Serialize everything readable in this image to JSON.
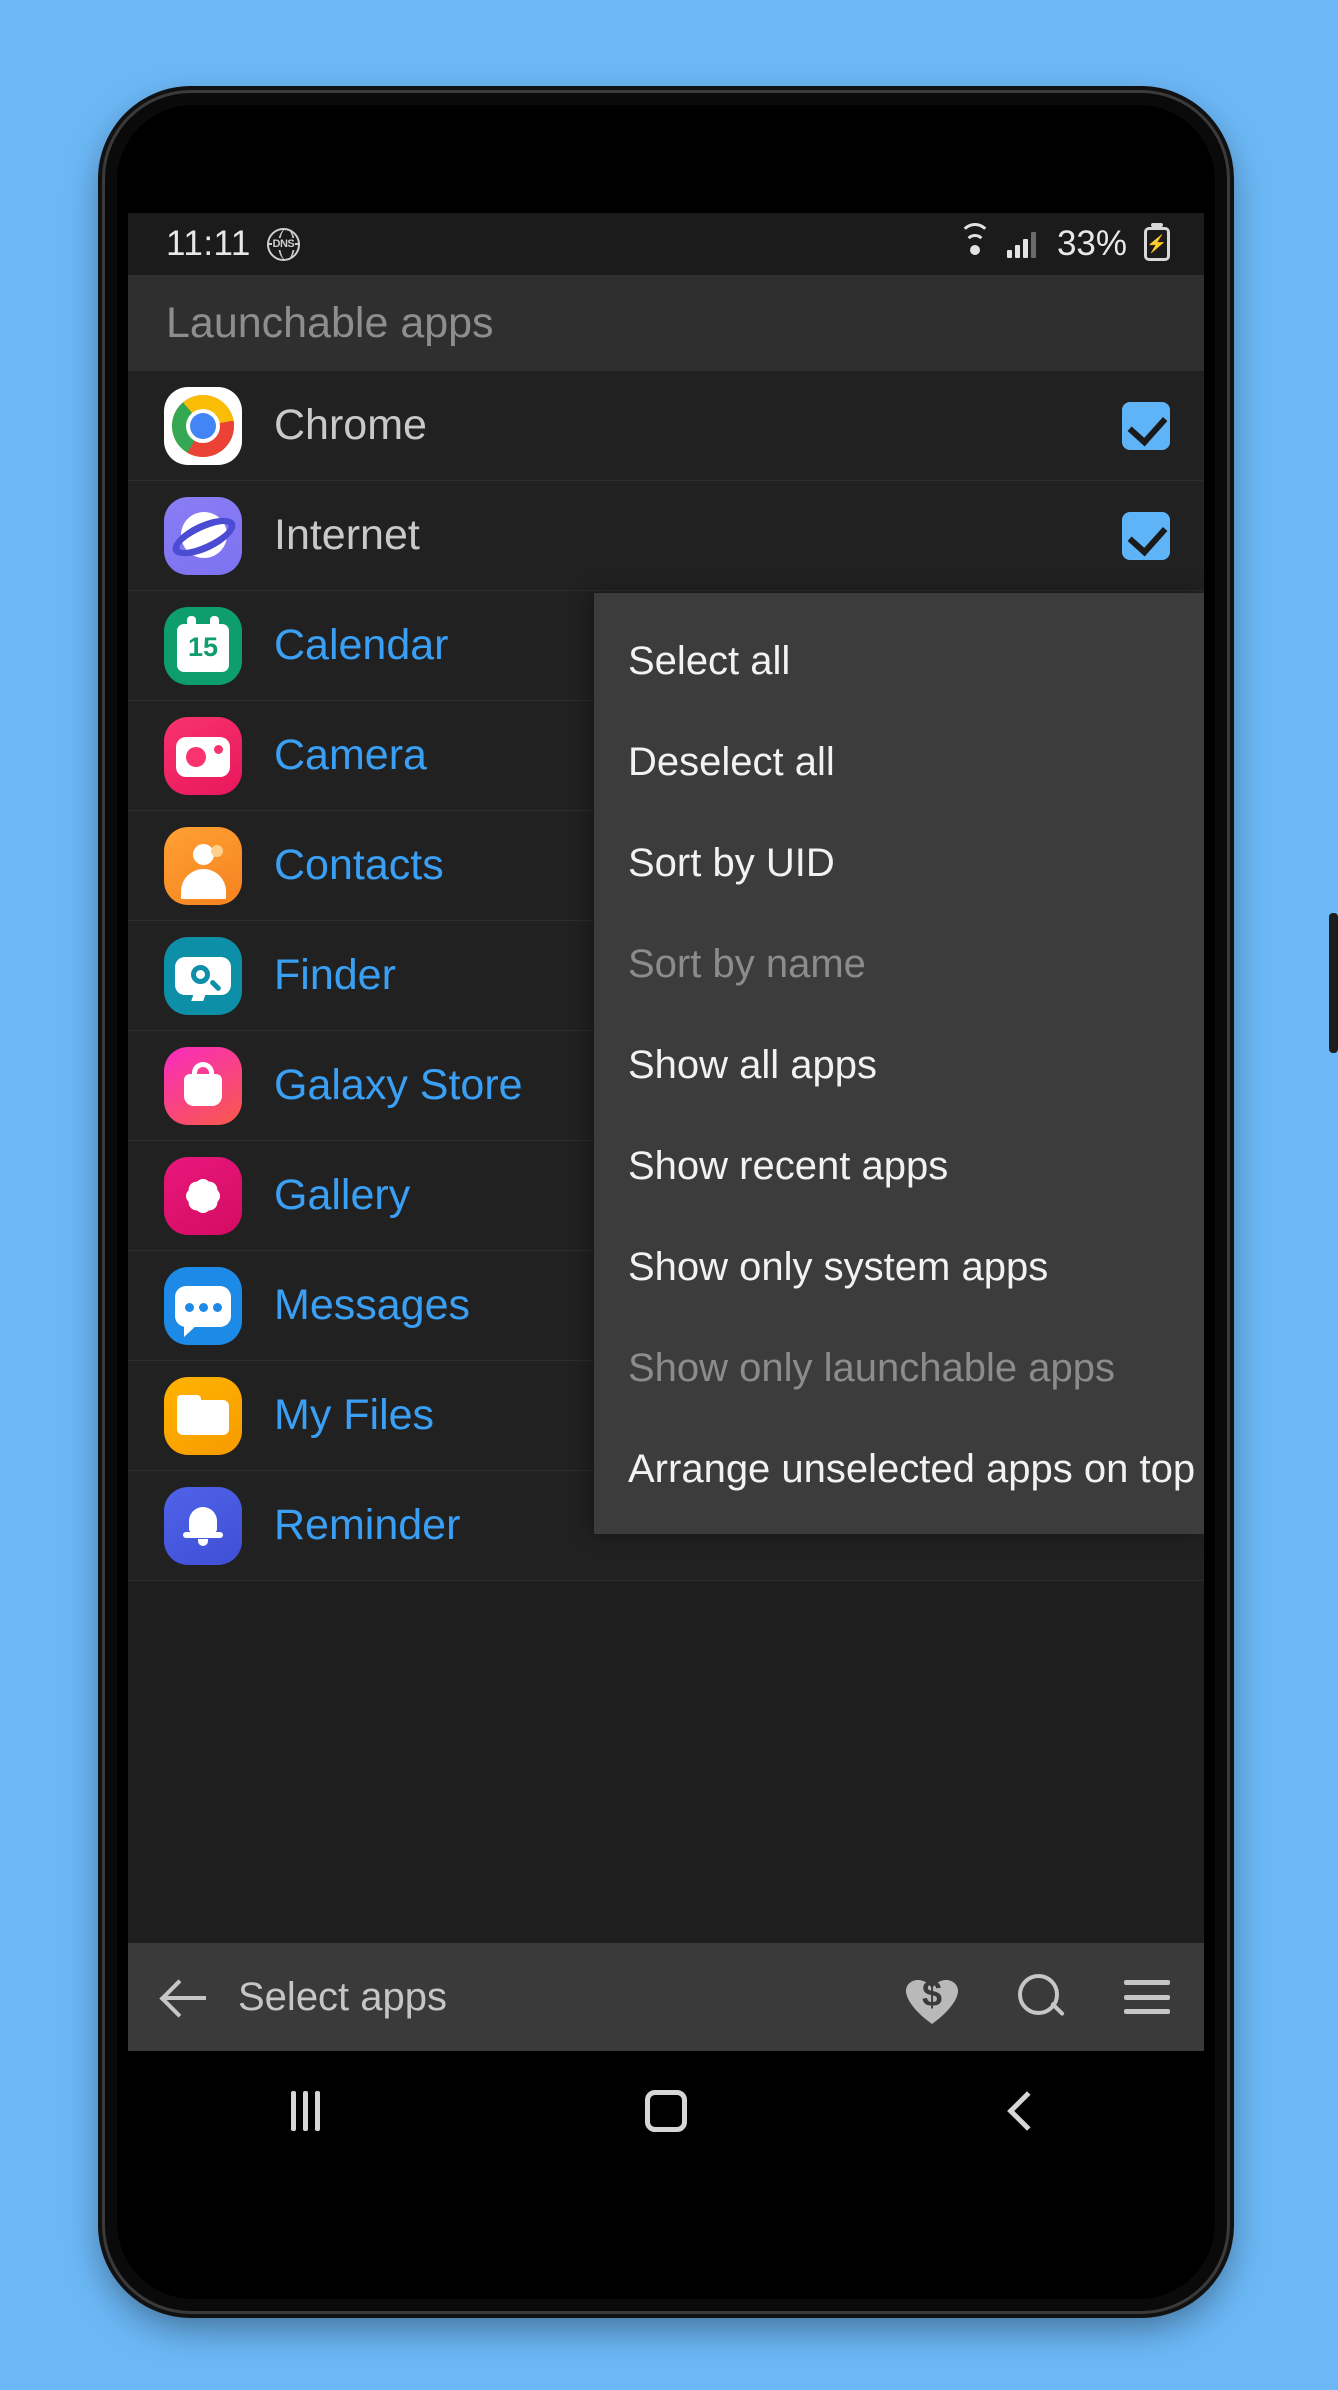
{
  "statusbar": {
    "time": "11:11",
    "dns_label": "DNS",
    "dns_icon": "dns-globe-icon",
    "wifi_icon": "wifi-icon",
    "signal_icon": "cellular-signal-icon",
    "battery_percent": "33%",
    "battery_icon": "battery-charging-icon"
  },
  "app_header": {
    "title": "Launchable apps"
  },
  "apps": [
    {
      "name": "Chrome",
      "icon": "chrome-icon",
      "checked": true,
      "dimmed": false
    },
    {
      "name": "Internet",
      "icon": "internet-icon",
      "checked": true,
      "dimmed": false
    },
    {
      "name": "Calendar",
      "icon": "calendar-icon",
      "checked": false,
      "dimmed": true
    },
    {
      "name": "Camera",
      "icon": "camera-icon",
      "checked": false,
      "dimmed": true
    },
    {
      "name": "Contacts",
      "icon": "contacts-icon",
      "checked": false,
      "dimmed": true
    },
    {
      "name": "Finder",
      "icon": "finder-icon",
      "checked": false,
      "dimmed": true
    },
    {
      "name": "Galaxy Store",
      "icon": "galaxy-store-icon",
      "checked": false,
      "dimmed": true
    },
    {
      "name": "Gallery",
      "icon": "gallery-icon",
      "checked": false,
      "dimmed": true
    },
    {
      "name": "Messages",
      "icon": "messages-icon",
      "checked": false,
      "dimmed": true
    },
    {
      "name": "My Files",
      "icon": "my-files-icon",
      "checked": false,
      "dimmed": true
    },
    {
      "name": "Reminder",
      "icon": "reminder-icon",
      "checked": false,
      "dimmed": true
    }
  ],
  "menu": {
    "items": [
      {
        "label": "Select all",
        "disabled": false
      },
      {
        "label": "Deselect all",
        "disabled": false
      },
      {
        "label": "Sort by UID",
        "disabled": false
      },
      {
        "label": "Sort by name",
        "disabled": true
      },
      {
        "label": "Show all apps",
        "disabled": false
      },
      {
        "label": "Show recent apps",
        "disabled": false
      },
      {
        "label": "Show only system apps",
        "disabled": false
      },
      {
        "label": "Show only launchable apps",
        "disabled": true
      },
      {
        "label": "Arrange unselected apps on top",
        "disabled": false
      }
    ]
  },
  "bottombar": {
    "back_icon": "back-arrow-icon",
    "title": "Select apps",
    "donate_icon": "heart-dollar-donate-icon",
    "donate_glyph": "$",
    "search_icon": "search-icon",
    "menu_icon": "hamburger-menu-icon"
  },
  "navbar": {
    "recents_icon": "recents-icon",
    "home_icon": "home-icon",
    "back_icon": "nav-back-icon"
  },
  "colors": {
    "wallpaper": "#6cb8f7",
    "accent_blue": "#3aa0f5",
    "checkbox_blue": "#5fb4f7",
    "surface": "#212121",
    "menu_surface": "#3c3c3c",
    "header_surface": "#2f2f2f"
  }
}
